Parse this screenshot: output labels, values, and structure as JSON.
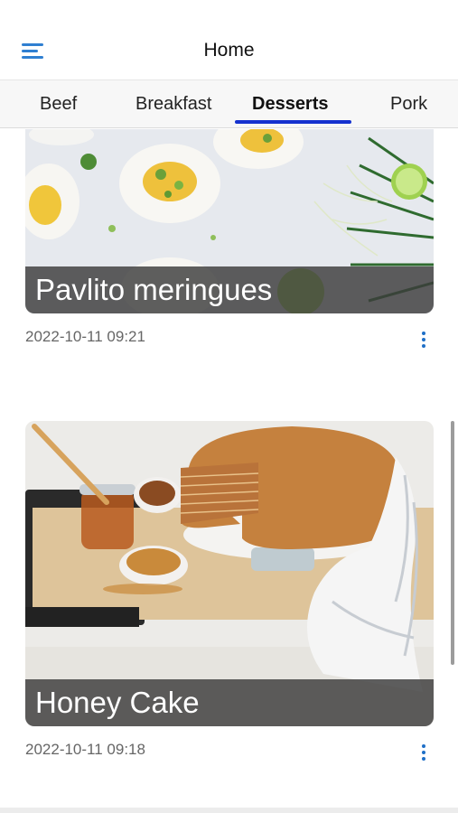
{
  "header": {
    "title": "Home",
    "menu_icon": "hamburger-menu-icon"
  },
  "tabs": [
    {
      "label": "Beef",
      "active": false
    },
    {
      "label": "Breakfast",
      "active": false
    },
    {
      "label": "Desserts",
      "active": true
    },
    {
      "label": "Pork",
      "active": false
    }
  ],
  "accent_color": "#1531cf",
  "posts": [
    {
      "title": "Pavlito meringues",
      "date": "2022-10-11 09:21",
      "more_icon": "more-vertical-icon"
    },
    {
      "title": "Honey Cake",
      "date": "2022-10-11 09:18",
      "more_icon": "more-vertical-icon"
    }
  ]
}
